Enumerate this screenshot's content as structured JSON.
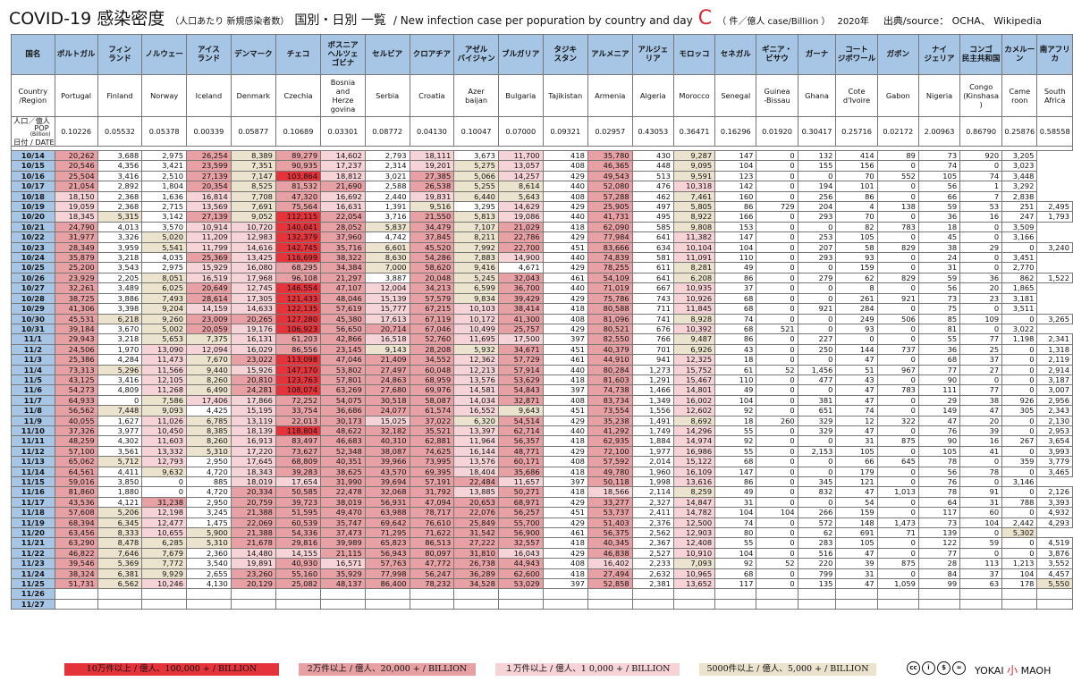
{
  "title": {
    "main": "COVID-19 感染密度",
    "sub": "（人口あたり 新規感染者数）",
    "mid": "国別・日別 一覧",
    "en": "/ New infection case per popuration by country and day",
    "letter": "C",
    "unit": "（ 件／億人 case/Billion ）",
    "year": "2020年",
    "source": "出典/source： OCHA、 Wikipedia"
  },
  "header": {
    "corner_jp": "国名",
    "corner_en": "Country\n/Region",
    "corner_pop_a": "人口／億人",
    "corner_pop_b": "POP",
    "corner_pop_c": "(Billion)",
    "corner_date": "日付 / DATE",
    "countries": [
      {
        "jp": "ポルトガル",
        "en": "Portugal",
        "pop": "0.10226"
      },
      {
        "jp": "フィン\nランド",
        "en": "Finland",
        "pop": "0.05532"
      },
      {
        "jp": "ノルウェー",
        "en": "Norway",
        "pop": "0.05378"
      },
      {
        "jp": "アイス\nランド",
        "en": "Iceland",
        "pop": "0.00339"
      },
      {
        "jp": "デンマーク",
        "en": "Denmark",
        "pop": "0.05877"
      },
      {
        "jp": "チェコ",
        "en": "Czechia",
        "pop": "0.10689"
      },
      {
        "jp": "ボスニア\nヘルツェ\nゴビナ",
        "en": "Bosnia\nand\nHerze\ngovina",
        "pop": "0.03301"
      },
      {
        "jp": "セルビア",
        "en": "Serbia",
        "pop": "0.08772"
      },
      {
        "jp": "クロアチア",
        "en": "Croatia",
        "pop": "0.04130"
      },
      {
        "jp": "アゼル\nバイジャン",
        "en": "Azer\nbaijan",
        "pop": "0.10047"
      },
      {
        "jp": "ブルガリア",
        "en": "Bulgaria",
        "pop": "0.07000"
      },
      {
        "jp": "タジキ\nスタン",
        "en": "Tajikistan",
        "pop": "0.09321"
      },
      {
        "jp": "アルメニア",
        "en": "Armenia",
        "pop": "0.02957"
      },
      {
        "jp": "アルジェ\nリア",
        "en": "Algeria",
        "pop": "0.43053"
      },
      {
        "jp": "モロッコ",
        "en": "Morocco",
        "pop": "0.36471"
      },
      {
        "jp": "セネガル",
        "en": "Senegal",
        "pop": "0.16296"
      },
      {
        "jp": "ギニア・\nビサウ",
        "en": "Guinea\n-Bissau",
        "pop": "0.01920"
      },
      {
        "jp": "ガーナ",
        "en": "Ghana",
        "pop": "0.30417"
      },
      {
        "jp": "コート\nジボワール",
        "en": "Cote\nd'Ivoire",
        "pop": "0.25716"
      },
      {
        "jp": "ガボン",
        "en": "Gabon",
        "pop": "0.02172"
      },
      {
        "jp": "ナイ\nジェリア",
        "en": "Nigeria",
        "pop": "2.00963"
      },
      {
        "jp": "コンゴ\n民主共和国",
        "en": "Congo\n(Kinshasa\n)",
        "pop": "0.86790"
      },
      {
        "jp": "カメルーン",
        "en": "Came\nroon",
        "pop": "0.25876"
      },
      {
        "jp": "南アフリカ",
        "en": "South\nAfrica",
        "pop": "0.58558"
      }
    ]
  },
  "rows": [
    [
      "10/14",
      "20,262",
      "3,688",
      "2,975",
      "26,254",
      "8,389",
      "89,279",
      "14,602",
      "2,793",
      "18,111",
      "3,673",
      "11,700",
      "418",
      "35,780",
      "430",
      "9,287",
      "147",
      "0",
      "132",
      "414",
      "89",
      "73",
      "920",
      "3,205"
    ],
    [
      "10/15",
      "20,546",
      "4,356",
      "3,421",
      "23,599",
      "7,351",
      "90,935",
      "17,237",
      "2,314",
      "19,201",
      "5,275",
      "13,057",
      "408",
      "46,365",
      "448",
      "9,095",
      "104",
      "0",
      "155",
      "156",
      "0",
      "74",
      "0",
      "3,023"
    ],
    [
      "10/16",
      "25,504",
      "3,416",
      "2,510",
      "27,139",
      "7,147",
      "103,864",
      "18,812",
      "3,021",
      "27,385",
      "5,066",
      "14,257",
      "429",
      "49,543",
      "513",
      "9,591",
      "123",
      "0",
      "0",
      "70",
      "552",
      "105",
      "74",
      "3,448"
    ],
    [
      "10/17",
      "21,054",
      "2,892",
      "1,804",
      "20,354",
      "8,525",
      "81,532",
      "21,690",
      "2,588",
      "26,538",
      "5,255",
      "8,614",
      "440",
      "52,080",
      "476",
      "10,318",
      "142",
      "0",
      "194",
      "101",
      "0",
      "56",
      "1",
      "3,292"
    ],
    [
      "10/18",
      "18,150",
      "2,368",
      "1,636",
      "16,814",
      "7,708",
      "47,320",
      "16,692",
      "2,440",
      "19,831",
      "6,440",
      "5,643",
      "408",
      "57,288",
      "462",
      "7,461",
      "160",
      "0",
      "256",
      "86",
      "0",
      "66",
      "7",
      "2,838"
    ],
    [
      "10/19",
      "19,059",
      "2,368",
      "2,715",
      "13,569",
      "7,691",
      "75,564",
      "16,631",
      "1,391",
      "9,516",
      "3,295",
      "14,629",
      "429",
      "25,905",
      "497",
      "5,805",
      "86",
      "729",
      "204",
      "4",
      "138",
      "59",
      "53",
      "251",
      "2,495"
    ],
    [
      "10/20",
      "18,345",
      "5,315",
      "3,142",
      "27,139",
      "9,052",
      "112,115",
      "22,054",
      "3,716",
      "21,550",
      "5,813",
      "19,086",
      "440",
      "41,731",
      "495",
      "8,922",
      "166",
      "0",
      "293",
      "70",
      "0",
      "36",
      "16",
      "247",
      "1,793"
    ],
    [
      "10/21",
      "24,790",
      "4,013",
      "3,570",
      "10,914",
      "10,720",
      "140,041",
      "28,052",
      "5,837",
      "34,479",
      "7,107",
      "21,029",
      "418",
      "62,090",
      "585",
      "9,808",
      "153",
      "0",
      "0",
      "82",
      "783",
      "18",
      "0",
      "3,509"
    ],
    [
      "10/22",
      "31,977",
      "3,326",
      "5,020",
      "11,209",
      "12,983",
      "132,379",
      "37,960",
      "4,742",
      "37,845",
      "8,211",
      "22,786",
      "429",
      "77,984",
      "641",
      "11,382",
      "147",
      "0",
      "253",
      "105",
      "0",
      "45",
      "0",
      "3,166"
    ],
    [
      "10/23",
      "28,349",
      "3,959",
      "5,541",
      "11,799",
      "14,616",
      "142,745",
      "35,716",
      "6,601",
      "45,520",
      "7,992",
      "22,700",
      "451",
      "83,666",
      "634",
      "10,104",
      "104",
      "0",
      "207",
      "58",
      "829",
      "38",
      "29",
      "0",
      "3,240"
    ],
    [
      "10/24",
      "35,879",
      "3,218",
      "4,035",
      "25,369",
      "13,425",
      "116,699",
      "38,322",
      "8,630",
      "54,286",
      "7,883",
      "14,900",
      "440",
      "74,839",
      "581",
      "11,091",
      "110",
      "0",
      "293",
      "93",
      "0",
      "24",
      "0",
      "3,451"
    ],
    [
      "10/25",
      "25,200",
      "3,543",
      "2,975",
      "15,929",
      "16,080",
      "68,295",
      "34,384",
      "7,000",
      "58,620",
      "9,416",
      "4,671",
      "429",
      "78,255",
      "611",
      "8,281",
      "49",
      "0",
      "0",
      "159",
      "0",
      "31",
      "0",
      "2,770"
    ],
    [
      "10/26",
      "23,929",
      "2,205",
      "8,051",
      "16,519",
      "17,968",
      "96,108",
      "21,297",
      "3,887",
      "20,048",
      "5,245",
      "32,043",
      "461",
      "54,109",
      "641",
      "6,208",
      "86",
      "0",
      "279",
      "62",
      "829",
      "59",
      "36",
      "862",
      "1,522"
    ],
    [
      "10/27",
      "32,261",
      "3,489",
      "6,025",
      "20,649",
      "12,745",
      "146,554",
      "47,107",
      "12,004",
      "34,213",
      "6,599",
      "36,700",
      "440",
      "71,019",
      "667",
      "10,935",
      "37",
      "0",
      "0",
      "8",
      "0",
      "56",
      "20",
      "1,865"
    ],
    [
      "10/28",
      "38,725",
      "3,886",
      "7,493",
      "28,614",
      "17,305",
      "121,433",
      "48,046",
      "15,139",
      "57,579",
      "9,834",
      "39,429",
      "429",
      "75,786",
      "743",
      "10,926",
      "68",
      "0",
      "0",
      "261",
      "921",
      "73",
      "23",
      "3,181"
    ],
    [
      "10/29",
      "41,306",
      "3,398",
      "9,204",
      "14,159",
      "14,633",
      "122,135",
      "57,619",
      "15,777",
      "67,215",
      "10,103",
      "38,414",
      "418",
      "80,588",
      "711",
      "11,845",
      "68",
      "0",
      "921",
      "284",
      "0",
      "75",
      "0",
      "3,511"
    ],
    [
      "10/30",
      "45,531",
      "6,218",
      "9,260",
      "23,009",
      "20,265",
      "127,280",
      "45,380",
      "17,613",
      "67,119",
      "10,172",
      "41,300",
      "408",
      "81,096",
      "741",
      "8,928",
      "74",
      "0",
      "0",
      "249",
      "506",
      "85",
      "109",
      "0",
      "3,265"
    ],
    [
      "10/31",
      "39,184",
      "3,670",
      "5,002",
      "20,059",
      "19,176",
      "106,923",
      "56,650",
      "20,714",
      "67,046",
      "10,499",
      "25,757",
      "429",
      "80,521",
      "676",
      "10,392",
      "68",
      "521",
      "0",
      "93",
      "0",
      "81",
      "0",
      "3,022"
    ],
    [
      "11/1",
      "29,943",
      "3,218",
      "5,653",
      "7,375",
      "16,131",
      "61,203",
      "42,866",
      "16,518",
      "52,760",
      "11,695",
      "17,500",
      "397",
      "82,550",
      "766",
      "9,487",
      "86",
      "0",
      "227",
      "0",
      "0",
      "55",
      "77",
      "1,198",
      "2,341"
    ],
    [
      "11/2",
      "24,506",
      "1,970",
      "13,090",
      "12,094",
      "16,029",
      "86,556",
      "23,145",
      "9,143",
      "28,208",
      "5,932",
      "34,671",
      "451",
      "40,379",
      "701",
      "6,926",
      "43",
      "0",
      "250",
      "144",
      "737",
      "36",
      "25",
      "0",
      "1,318"
    ],
    [
      "11/3",
      "25,386",
      "4,284",
      "11,473",
      "7,670",
      "23,022",
      "113,098",
      "47,046",
      "21,409",
      "34,552",
      "12,362",
      "57,729",
      "461",
      "44,910",
      "941",
      "12,325",
      "18",
      "0",
      "0",
      "47",
      "0",
      "68",
      "37",
      "0",
      "2,119"
    ],
    [
      "11/4",
      "73,313",
      "5,296",
      "11,566",
      "9,440",
      "15,926",
      "147,170",
      "53,802",
      "27,497",
      "60,048",
      "12,213",
      "57,914",
      "440",
      "80,284",
      "1,273",
      "15,752",
      "61",
      "52",
      "1,456",
      "51",
      "967",
      "77",
      "27",
      "0",
      "2,914"
    ],
    [
      "11/5",
      "43,125",
      "3,416",
      "12,105",
      "8,260",
      "20,810",
      "123,763",
      "57,801",
      "24,863",
      "68,959",
      "13,576",
      "53,629",
      "418",
      "81,603",
      "1,291",
      "15,467",
      "110",
      "0",
      "477",
      "43",
      "0",
      "90",
      "0",
      "0",
      "3,187"
    ],
    [
      "11/6",
      "54,273",
      "4,809",
      "11,268",
      "6,490",
      "24,281",
      "108,074",
      "63,269",
      "27,680",
      "69,976",
      "14,581",
      "54,843",
      "397",
      "74,738",
      "1,466",
      "14,801",
      "49",
      "0",
      "0",
      "47",
      "783",
      "111",
      "77",
      "0",
      "3,007"
    ],
    [
      "11/7",
      "64,933",
      "0",
      "7,586",
      "17,406",
      "17,866",
      "72,252",
      "54,075",
      "30,518",
      "58,087",
      "14,034",
      "32,871",
      "408",
      "83,734",
      "1,349",
      "16,002",
      "104",
      "0",
      "381",
      "47",
      "0",
      "29",
      "38",
      "926",
      "2,956"
    ],
    [
      "11/8",
      "56,562",
      "7,448",
      "9,093",
      "4,425",
      "15,195",
      "33,754",
      "36,686",
      "24,077",
      "61,574",
      "16,552",
      "9,643",
      "451",
      "73,554",
      "1,556",
      "12,602",
      "92",
      "0",
      "651",
      "74",
      "0",
      "149",
      "47",
      "305",
      "2,343"
    ],
    [
      "11/9",
      "40,055",
      "1,627",
      "11,026",
      "6,785",
      "13,119",
      "22,013",
      "30,173",
      "15,025",
      "37,022",
      "6,320",
      "54,514",
      "429",
      "35,238",
      "1,491",
      "8,692",
      "18",
      "260",
      "329",
      "12",
      "322",
      "47",
      "20",
      "0",
      "2,130"
    ],
    [
      "11/10",
      "37,326",
      "3,977",
      "10,450",
      "8,385",
      "18,139",
      "118,804",
      "48,622",
      "32,182",
      "35,521",
      "13,397",
      "62,714",
      "440",
      "41,292",
      "1,749",
      "14,296",
      "55",
      "0",
      "329",
      "47",
      "0",
      "76",
      "39",
      "0",
      "2,953"
    ],
    [
      "11/11",
      "48,259",
      "4,302",
      "11,603",
      "8,260",
      "16,913",
      "83,497",
      "46,683",
      "40,310",
      "62,881",
      "11,964",
      "56,357",
      "418",
      "62,935",
      "1,884",
      "14,974",
      "92",
      "0",
      "0",
      "31",
      "875",
      "90",
      "16",
      "267",
      "3,654"
    ],
    [
      "11/12",
      "57,100",
      "3,561",
      "13,332",
      "5,310",
      "17,220",
      "73,627",
      "52,348",
      "38,087",
      "74,625",
      "16,144",
      "48,771",
      "429",
      "72,100",
      "1,977",
      "16,986",
      "55",
      "0",
      "2,153",
      "105",
      "0",
      "105",
      "41",
      "0",
      "3,993"
    ],
    [
      "11/13",
      "65,062",
      "5,712",
      "12,793",
      "2,950",
      "17,645",
      "68,809",
      "40,351",
      "39,966",
      "73,995",
      "13,576",
      "60,171",
      "408",
      "57,592",
      "2,014",
      "15,122",
      "68",
      "0",
      "0",
      "66",
      "645",
      "78",
      "0",
      "359",
      "3,779"
    ],
    [
      "11/14",
      "64,561",
      "4,411",
      "9,632",
      "4,720",
      "18,343",
      "39,283",
      "38,625",
      "43,570",
      "69,395",
      "18,404",
      "35,686",
      "418",
      "49,780",
      "1,960",
      "16,109",
      "147",
      "0",
      "0",
      "179",
      "0",
      "56",
      "78",
      "0",
      "3,465"
    ],
    [
      "11/15",
      "59,016",
      "3,850",
      "0",
      "885",
      "18,019",
      "17,654",
      "31,990",
      "39,694",
      "57,191",
      "22,484",
      "11,657",
      "397",
      "50,118",
      "1,998",
      "13,616",
      "86",
      "0",
      "345",
      "121",
      "0",
      "76",
      "0",
      "3,146"
    ],
    [
      "11/16",
      "81,860",
      "1,880",
      "0",
      "4,720",
      "20,334",
      "50,585",
      "22,478",
      "32,068",
      "31,792",
      "13,885",
      "50,271",
      "418",
      "18,566",
      "2,114",
      "8,259",
      "49",
      "0",
      "832",
      "47",
      "1,013",
      "78",
      "91",
      "0",
      "2,126"
    ],
    [
      "11/17",
      "43,536",
      "4,121",
      "31,238",
      "2,950",
      "20,759",
      "39,723",
      "38,019",
      "56,931",
      "47,094",
      "20,653",
      "68,971",
      "429",
      "33,277",
      "2,327",
      "14,847",
      "31",
      "0",
      "0",
      "54",
      "0",
      "64",
      "31",
      "788",
      "3,393"
    ],
    [
      "11/18",
      "57,608",
      "5,206",
      "12,198",
      "3,245",
      "21,388",
      "51,595",
      "49,470",
      "63,988",
      "78,717",
      "22,076",
      "56,257",
      "451",
      "53,737",
      "2,411",
      "14,782",
      "104",
      "104",
      "266",
      "159",
      "0",
      "117",
      "60",
      "0",
      "4,932"
    ],
    [
      "11/19",
      "68,394",
      "6,345",
      "12,477",
      "1,475",
      "22,069",
      "60,539",
      "35,747",
      "69,642",
      "76,610",
      "25,849",
      "55,700",
      "429",
      "51,403",
      "2,376",
      "12,500",
      "74",
      "0",
      "572",
      "148",
      "1,473",
      "73",
      "104",
      "2,442",
      "4,293"
    ],
    [
      "11/20",
      "63,456",
      "8,333",
      "10,655",
      "5,900",
      "21,388",
      "54,336",
      "37,473",
      "71,295",
      "71,622",
      "31,542",
      "56,900",
      "461",
      "56,375",
      "2,562",
      "12,903",
      "80",
      "0",
      "62",
      "691",
      "71",
      "139",
      "0",
      "5,302"
    ],
    [
      "11/21",
      "63,290",
      "8,478",
      "6,285",
      "5,310",
      "21,678",
      "29,816",
      "39,989",
      "65,823",
      "86,513",
      "27,222",
      "32,557",
      "418",
      "40,345",
      "2,367",
      "12,408",
      "55",
      "0",
      "283",
      "105",
      "0",
      "122",
      "59",
      "0",
      "4,519"
    ],
    [
      "11/22",
      "46,822",
      "7,646",
      "7,679",
      "2,360",
      "14,480",
      "14,155",
      "21,115",
      "56,943",
      "80,097",
      "31,810",
      "16,043",
      "429",
      "46,838",
      "2,527",
      "10,910",
      "104",
      "0",
      "516",
      "47",
      "0",
      "77",
      "0",
      "0",
      "3,876"
    ],
    [
      "11/23",
      "39,546",
      "5,369",
      "7,772",
      "3,540",
      "19,891",
      "40,930",
      "16,571",
      "57,763",
      "47,772",
      "26,738",
      "44,943",
      "408",
      "16,402",
      "2,233",
      "7,093",
      "92",
      "52",
      "220",
      "39",
      "875",
      "28",
      "113",
      "1,213",
      "3,552"
    ],
    [
      "11/24",
      "38,324",
      "6,381",
      "9,929",
      "2,655",
      "23,260",
      "55,160",
      "35,929",
      "77,998",
      "56,247",
      "36,289",
      "62,600",
      "418",
      "27,494",
      "2,632",
      "10,965",
      "68",
      "0",
      "799",
      "31",
      "0",
      "84",
      "37",
      "104",
      "4,457"
    ],
    [
      "11/25",
      "51,731",
      "6,562",
      "10,246",
      "4,130",
      "20,129",
      "25,082",
      "48,137",
      "86,400",
      "78,232",
      "34,528",
      "53,029",
      "397",
      "52,858",
      "2,381",
      "13,652",
      "117",
      "0",
      "135",
      "47",
      "1,059",
      "99",
      "63",
      "178",
      "5,550"
    ],
    [
      "11/26",
      "",
      "",
      "",
      "",
      "",
      "",
      "",
      "",
      "",
      "",
      "",
      "",
      "",
      "",
      "",
      "",
      "",
      "",
      "",
      "",
      "",
      "",
      "",
      ""
    ],
    [
      "11/27",
      "",
      "",
      "",
      "",
      "",
      "",
      "",
      "",
      "",
      "",
      "",
      "",
      "",
      "",
      "",
      "",
      "",
      "",
      "",
      "",
      "",
      "",
      "",
      ""
    ]
  ],
  "legend": [
    {
      "label": "10万件以上 / 億人、100,000 + / BILLION",
      "color": "#e4333a"
    },
    {
      "label": "2万件以上 / 億人、20,000 + / BILLION",
      "color": "#e7a0a4"
    },
    {
      "label": "１万件以上 / 億人、1 0,000 + / BILLION",
      "color": "#f6d3d6"
    },
    {
      "label": "5000件以上 / 億人、5,000 + / BILLION",
      "color": "#ece3cf"
    }
  ],
  "cc_icons": [
    "cc",
    "by",
    "nc",
    "nd"
  ],
  "brand": {
    "a": "YOKAI",
    "b": "小",
    "c": "MAOH"
  }
}
